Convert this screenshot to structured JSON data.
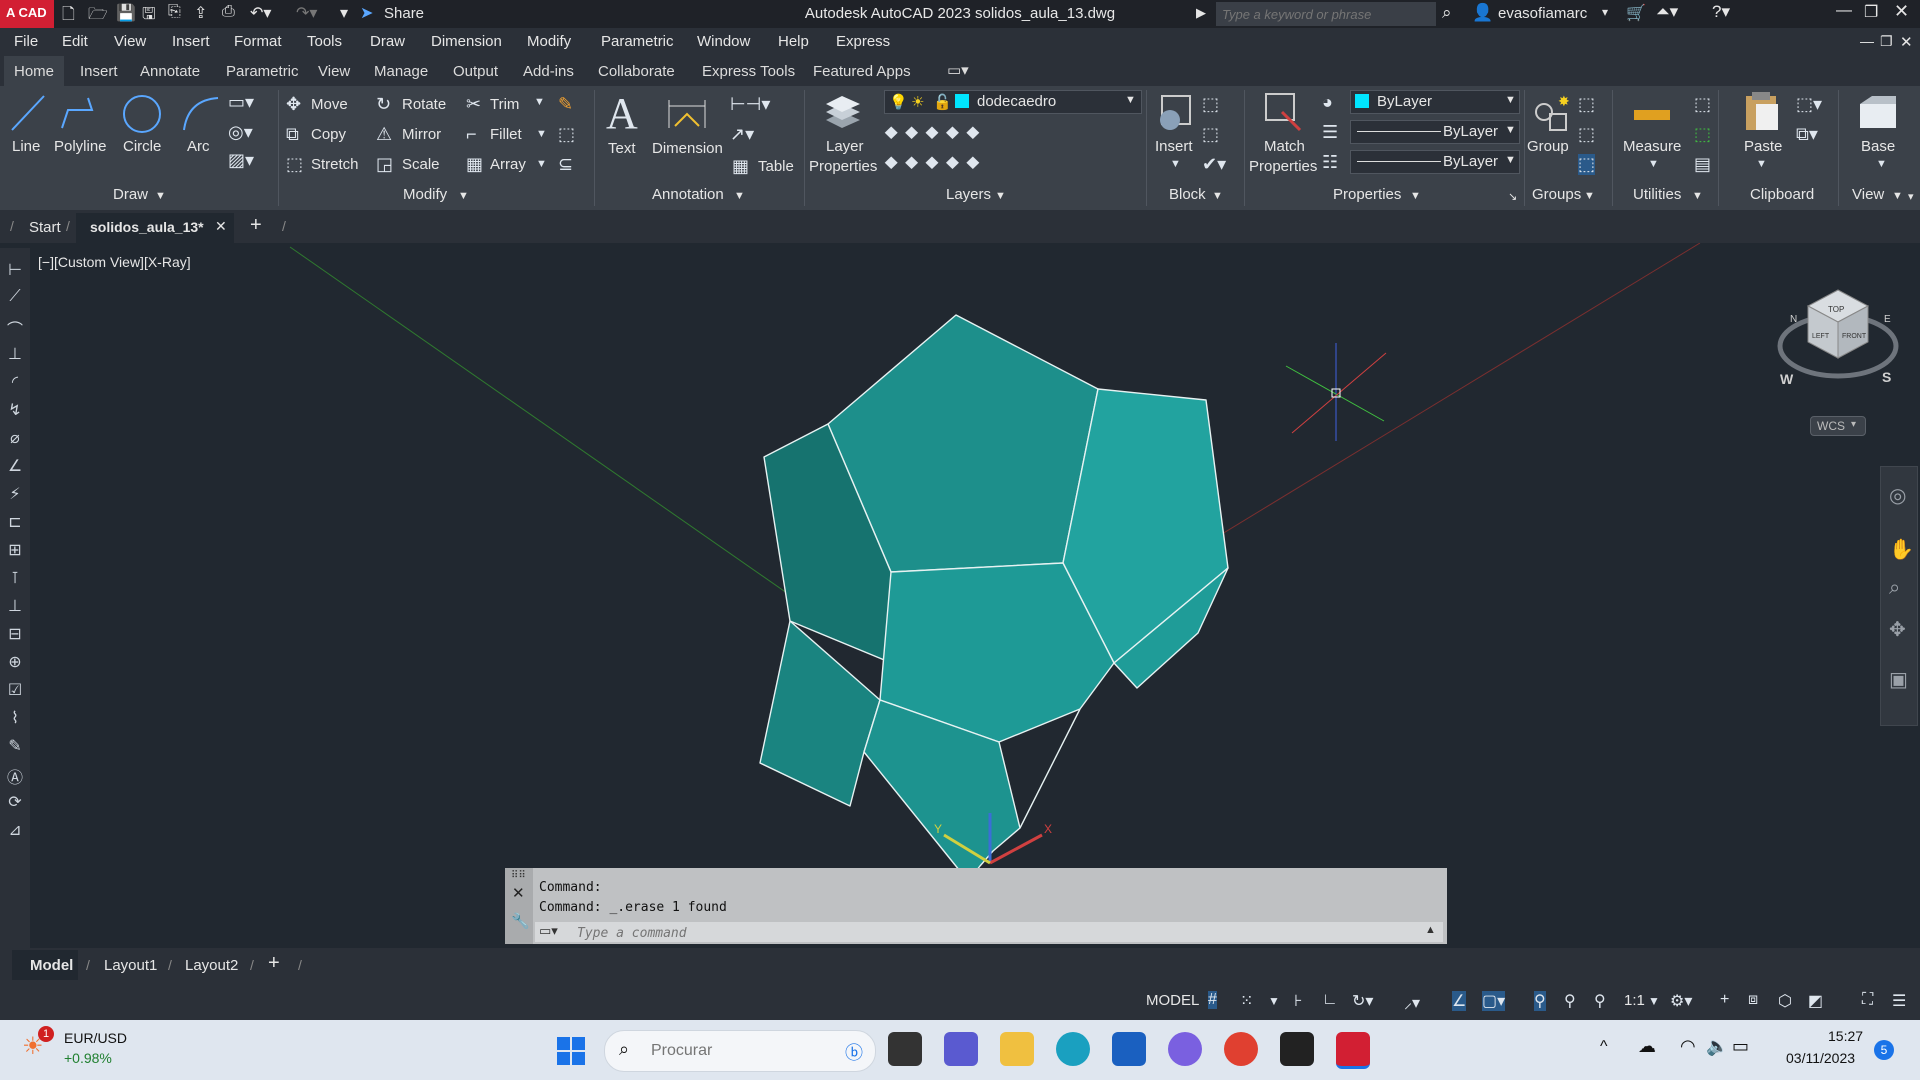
{
  "titlebar": {
    "logo_text": "A CAD",
    "share_label": "Share",
    "title": "Autodesk AutoCAD 2023    solidos_aula_13.dwg",
    "search_placeholder": "Type a keyword or phrase",
    "user": "evasofiamarc"
  },
  "menubar": [
    "File",
    "Edit",
    "View",
    "Insert",
    "Format",
    "Tools",
    "Draw",
    "Dimension",
    "Modify",
    "Parametric",
    "Window",
    "Help",
    "Express"
  ],
  "ribbon_tabs": [
    "Home",
    "Insert",
    "Annotate",
    "Parametric",
    "View",
    "Manage",
    "Output",
    "Add-ins",
    "Collaborate",
    "Express Tools",
    "Featured Apps"
  ],
  "ribbon": {
    "draw": {
      "line": "Line",
      "polyline": "Polyline",
      "circle": "Circle",
      "arc": "Arc",
      "footer": "Draw"
    },
    "modify": {
      "move": "Move",
      "rotate": "Rotate",
      "trim": "Trim",
      "copy": "Copy",
      "mirror": "Mirror",
      "fillet": "Fillet",
      "stretch": "Stretch",
      "scale": "Scale",
      "array": "Array",
      "footer": "Modify"
    },
    "annotation": {
      "text": "Text",
      "dimension": "Dimension",
      "table": "Table",
      "footer": "Annotation"
    },
    "layers": {
      "layer_properties_1": "Layer",
      "layer_properties_2": "Properties",
      "current_layer": "dodecaedro",
      "footer": "Layers"
    },
    "block": {
      "insert": "Insert",
      "footer": "Block"
    },
    "properties": {
      "match_1": "Match",
      "match_2": "Properties",
      "color": "ByLayer",
      "lineweight": "ByLayer",
      "linetype": "ByLayer",
      "footer": "Properties"
    },
    "groups": {
      "group": "Group",
      "footer": "Groups"
    },
    "utilities": {
      "measure": "Measure",
      "footer": "Utilities"
    },
    "clipboard": {
      "paste": "Paste",
      "footer": "Clipboard"
    },
    "view": {
      "base": "Base",
      "footer": "View"
    }
  },
  "doc_tabs": {
    "start": "Start",
    "active": "solidos_aula_13*"
  },
  "viewport": {
    "label": "[−][Custom View][X-Ray]",
    "viewcube_top": "TOP",
    "viewcube_left": "LEFT",
    "viewcube_front": "FRONT",
    "compass_w": "W",
    "compass_s": "S",
    "compass_n": "N",
    "compass_e": "E",
    "wcs": "WCS"
  },
  "command": {
    "line1": "Command:",
    "line2": "Command: _.erase 1 found",
    "placeholder": "Type a command"
  },
  "layout_tabs": [
    "Model",
    "Layout1",
    "Layout2"
  ],
  "statusbar": {
    "model": "MODEL",
    "scale": "1:1"
  },
  "taskbar": {
    "widget_name": "EUR/USD",
    "widget_value": "+0.98%",
    "widget_badge": "1",
    "search_placeholder": "Procurar",
    "time": "15:27",
    "date": "03/11/2023",
    "notif": "5"
  },
  "colors": {
    "accent": "#3a86d6",
    "solid_fill": "#1c8f8c",
    "solid_light": "#23a5a1",
    "autocad_red": "#d21f33",
    "color_swatch": "#00e5ff"
  }
}
